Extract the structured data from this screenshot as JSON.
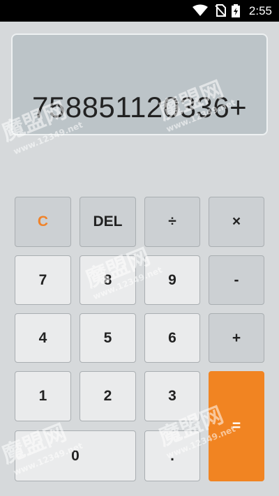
{
  "status": {
    "time": "2:55",
    "icons": [
      "wifi-icon",
      "no-sim-icon",
      "battery-charging-icon"
    ]
  },
  "display": {
    "expression": "758851120336+"
  },
  "keys": {
    "clear": "C",
    "delete": "DEL",
    "divide": "÷",
    "multiply": "×",
    "seven": "7",
    "eight": "8",
    "nine": "9",
    "minus": "-",
    "four": "4",
    "five": "5",
    "six": "6",
    "plus": "+",
    "one": "1",
    "two": "2",
    "three": "3",
    "equals": "=",
    "zero": "0",
    "dot": "."
  },
  "watermark": {
    "brand": "魔盟网",
    "url": "www.12349.net"
  },
  "colors": {
    "accent": "#f18422",
    "clear_text": "#f0832a",
    "display_bg": "#bcc4c8",
    "operator_bg": "#ccd0d3",
    "number_bg": "#eaebec",
    "app_bg": "#d6d9db"
  }
}
